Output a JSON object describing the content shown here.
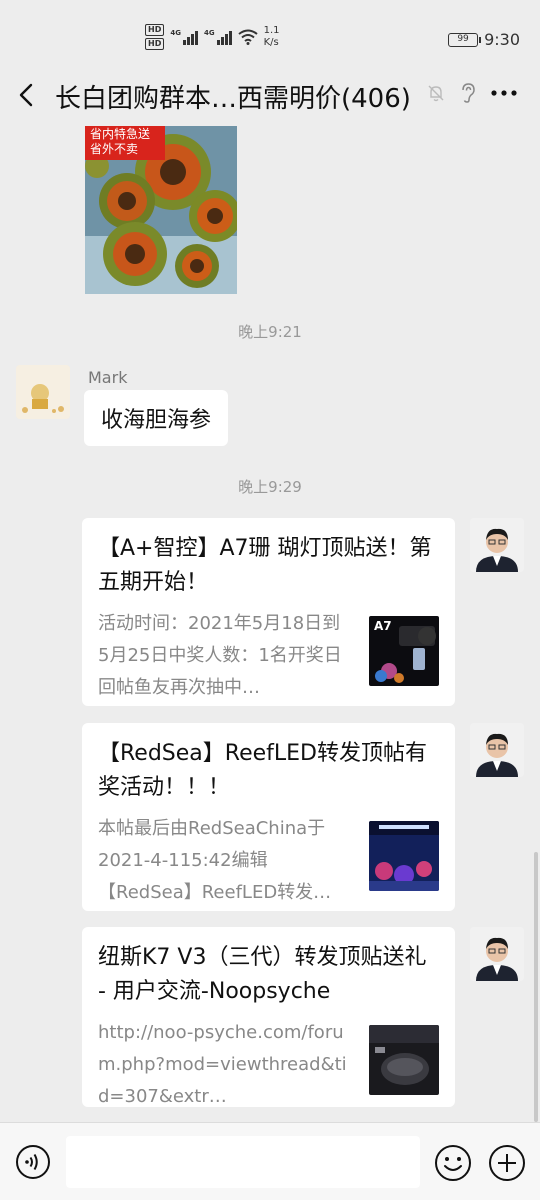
{
  "status_bar": {
    "hd1": "HD",
    "hd2": "HD",
    "net1": "4G",
    "net2": "4G",
    "speed_value": "1.1",
    "speed_unit": "K/s",
    "battery": "99",
    "time": "9:30"
  },
  "header": {
    "title": "长白团购群本…西需明价(406)"
  },
  "image_message": {
    "overlay_line1": "省内特急送",
    "overlay_line2": "省外不卖"
  },
  "messages": {
    "time1": "晚上9:21",
    "mark_sender": "Mark",
    "mark_text": "收海胆海参",
    "time2": "晚上9:29"
  },
  "cards": [
    {
      "title": "【A+智控】A7珊 瑚灯顶贴送！第五期开始！",
      "desc": "活动时间：2021年5月18日到5月25日中奖人数：1名开奖日回帖鱼友再次抽中…",
      "thumb_label": "A7"
    },
    {
      "title": "【RedSea】ReefLED转发顶帖有奖活动！！！",
      "desc": "本帖最后由RedSeaChina于2021-4-115:42编辑【RedSea】ReefLED转发…",
      "thumb_label": ""
    },
    {
      "title": "纽斯K7 V3（三代）转发顶贴送礼 - 用户交流-Noopsyche",
      "desc": "http://noo-psyche.com/forum.php?mod=viewthread&tid=307&extr…",
      "thumb_label": ""
    }
  ],
  "icons": {
    "back": "chevron-left-icon",
    "mute": "bell-off-icon",
    "ear": "ear-icon",
    "more": "more-icon",
    "voice": "voice-icon",
    "emoji": "emoji-icon",
    "plus": "plus-icon"
  }
}
